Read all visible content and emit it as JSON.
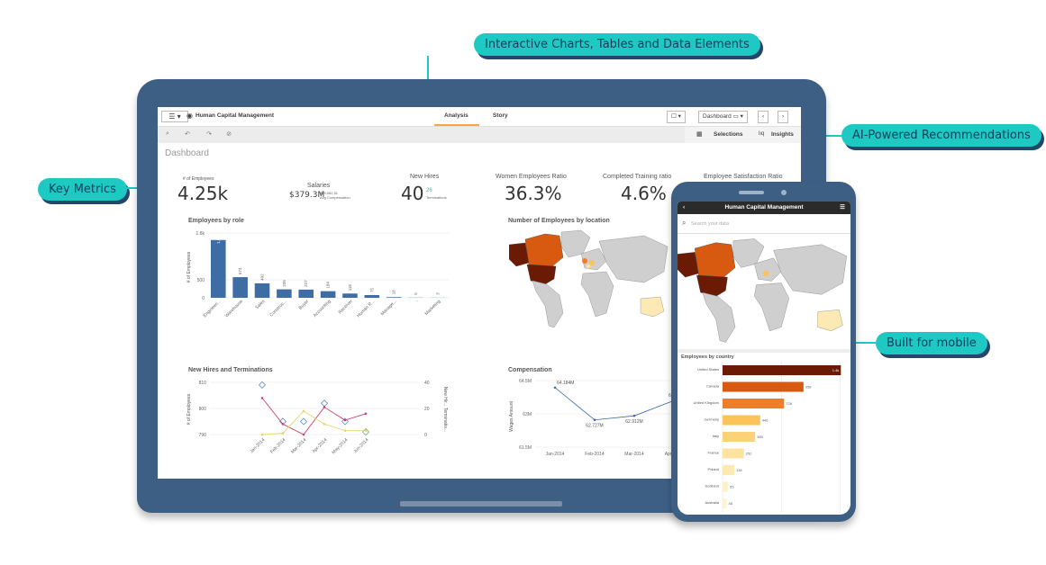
{
  "callouts": {
    "interactive": "Interactive Charts, Tables and Data Elements",
    "ai": "AI-Powered Recommendations",
    "key_metrics": "Key Metrics",
    "mobile": "Built for mobile"
  },
  "app": {
    "title": "Human Capital Management",
    "tabs": [
      {
        "label": "Analysis",
        "active": true
      },
      {
        "label": "Story",
        "active": false
      }
    ],
    "sheet_selector": "Dashboard",
    "selections_label": "Selections",
    "insights_label": "Insights",
    "sheet_title": "Dashboard"
  },
  "kpis": {
    "employees": {
      "label": "# of Employees",
      "value": "4.25k"
    },
    "salaries": {
      "label": "Salaries",
      "value": "$379.3M",
      "sub_value": "$79,082.51",
      "sub_label": "Avg Compensation"
    },
    "new_hires": {
      "label": "New Hires",
      "value": "40",
      "sub_value": "26",
      "sub_label": "Terminations"
    },
    "women_ratio": {
      "label": "Women Employees Ratio",
      "value": "36.3%"
    },
    "training_ratio": {
      "label": "Completed Training ratio",
      "value": "4.6%"
    },
    "satisfaction_ratio": {
      "label": "Employee Satisfaction Ratio"
    }
  },
  "map": {
    "title": "Number of Employees by location"
  },
  "chart_data": [
    {
      "type": "bar",
      "title": "Employees by role",
      "ylabel": "# of Employees",
      "categories": [
        "Engineeri...",
        "Warehouse",
        "Sales",
        "Construc...",
        "Buyer",
        "Accounting",
        "Receiver",
        "Human R...",
        "Manage...",
        "-",
        "Marketing"
      ],
      "values": [
        1606,
        573,
        402,
        235,
        227,
        184,
        118,
        75,
        18,
        5,
        3
      ],
      "value_labels": [
        "1,606",
        "573",
        "402",
        "235",
        "227",
        "184",
        "118",
        "75",
        "18",
        "5",
        "3"
      ],
      "yticks": [
        "0",
        "500",
        "1.8k"
      ],
      "ylim": [
        0,
        1800
      ],
      "color": "#3e6da6"
    },
    {
      "type": "line",
      "title": "New Hires and Terminations",
      "ylabel": "# of Employees",
      "y2label": "New Hir... Terminatio...",
      "categories": [
        "Jan-2014",
        "Feb-2014",
        "Mar-2014",
        "Apr-2014",
        "May-2014",
        "Jun-2014"
      ],
      "yticks": [
        "790",
        "800",
        "810"
      ],
      "ylim": [
        790,
        810
      ],
      "y2ticks": [
        "0",
        "20",
        "40"
      ],
      "y2lim": [
        0,
        40
      ],
      "series": [
        {
          "name": "# of Employees",
          "axis": "left",
          "style": "diamond",
          "color": "#5b8fc9",
          "values": [
            809,
            795,
            795,
            802,
            795,
            791
          ]
        },
        {
          "name": "New Hires",
          "axis": "right",
          "style": "line",
          "color": "#c9436b",
          "values": [
            28,
            8,
            0,
            21,
            11,
            16
          ]
        },
        {
          "name": "Terminations",
          "axis": "right",
          "style": "line",
          "color": "#e8d36a",
          "values": [
            0,
            1,
            18,
            8,
            3,
            3
          ]
        }
      ]
    },
    {
      "type": "line",
      "title": "Compensation",
      "ylabel": "Wages Amount",
      "categories": [
        "Jan-2014",
        "Feb-2014",
        "Mar-2014",
        "Apr-2014"
      ],
      "values": [
        64.184,
        62.727,
        62.912,
        63.6
      ],
      "value_labels": [
        "64.184M",
        "62.727M",
        "62.912M",
        "63.…"
      ],
      "yticks": [
        "61.5M",
        "63M",
        "64.5M"
      ],
      "ylim": [
        61.5,
        64.5
      ],
      "color": "#3e6da6"
    },
    {
      "type": "bar",
      "orientation": "horizontal",
      "title": "Employees by country",
      "categories": [
        "United States",
        "Canada",
        "United Kingdom",
        "Germany",
        "Italy",
        "France",
        "Poland",
        "Scotland",
        "Australia"
      ],
      "values": [
        1400,
        958,
        728,
        446,
        385,
        252,
        138,
        65,
        48
      ],
      "value_labels": [
        "1.4k",
        "958",
        "728",
        "446",
        "385",
        "252",
        "138",
        "65",
        "48"
      ],
      "colors": [
        "#6b1a04",
        "#d85a10",
        "#f07e26",
        "#fbc35a",
        "#fbd278",
        "#fce3a0",
        "#fde9b4",
        "#fef0c8",
        "#fef3d2"
      ],
      "xlim": [
        0,
        1450
      ]
    }
  ],
  "mobile": {
    "title": "Human Capital Management",
    "search_placeholder": "Search your data"
  }
}
